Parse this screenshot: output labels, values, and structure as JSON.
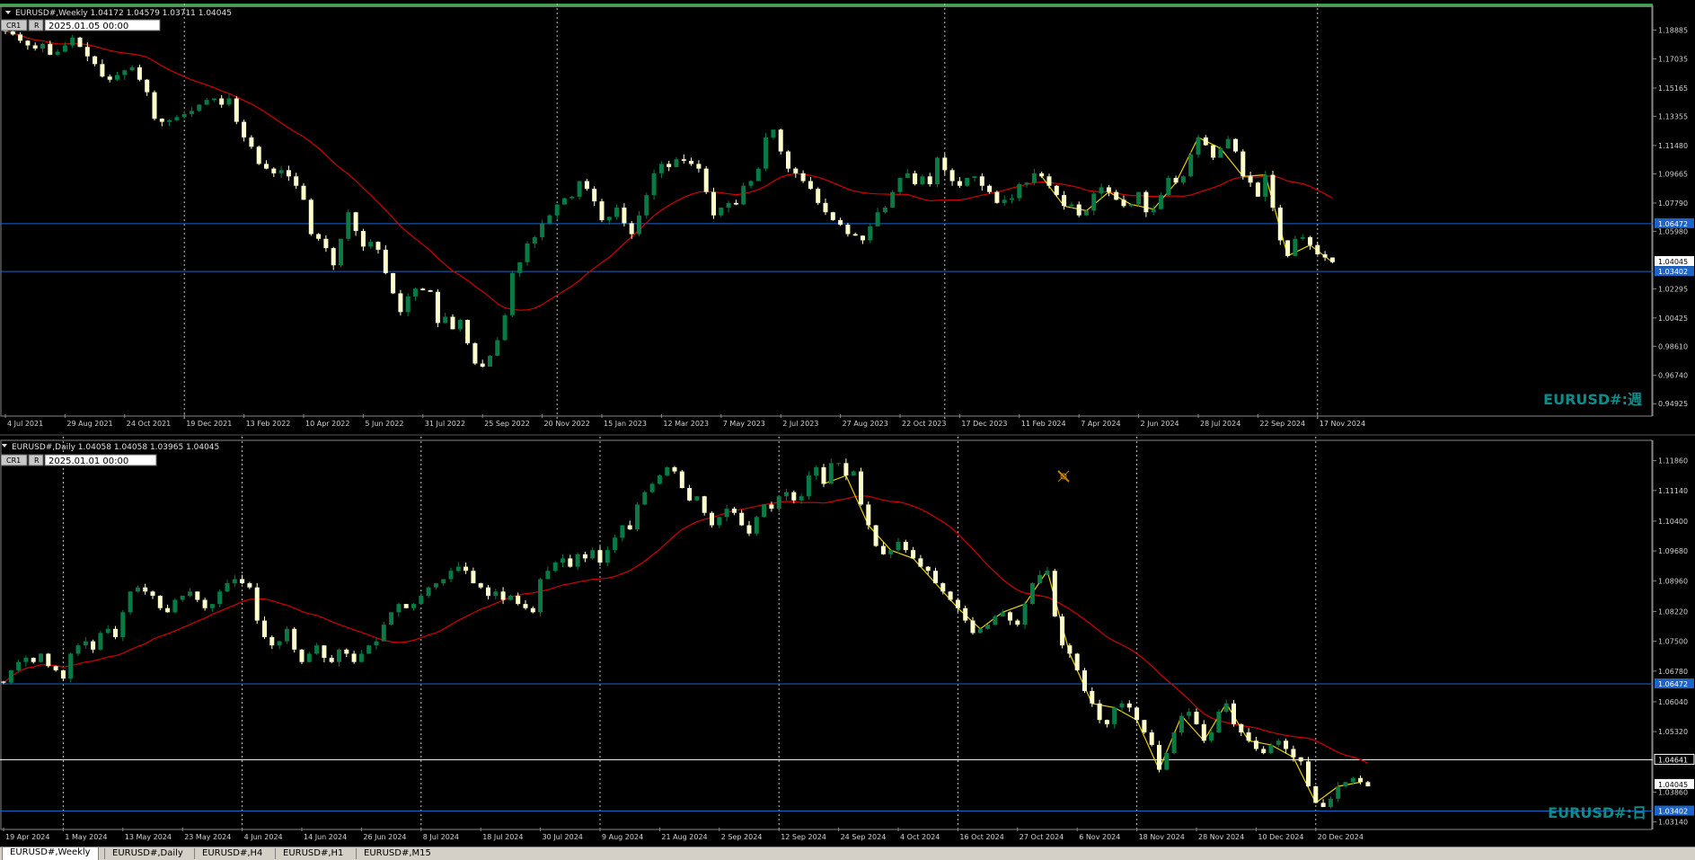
{
  "colors": {
    "background": "#000000",
    "bull_candle": "#0a7a45",
    "bear_candle": "#ffffcc",
    "ma_line": "#d40000",
    "zigzag": "#e8d000",
    "hline": "#1e64c8",
    "vgrid": "#c0c0c0",
    "label_color": "#0d8c8c",
    "top_border": "#2ea043",
    "axis_text": "#d0d0d0",
    "hline_tag": "#1e64c8",
    "price_tag": "#ffffff"
  },
  "tabs": [
    {
      "label": "EURUSD#,Weekly",
      "active": true
    },
    {
      "label": "EURUSD#,Daily",
      "active": false
    },
    {
      "label": "EURUSD#,H4",
      "active": false
    },
    {
      "label": "EURUSD#,H1",
      "active": false
    },
    {
      "label": "EURUSD#,M15",
      "active": false
    }
  ],
  "chart_data": [
    {
      "type": "candlestick",
      "header": "EURUSD#,Weekly  1.04172 1.04579 1.03711 1.04045",
      "cr_label": "CR1",
      "r_label": "R",
      "date_box": "2025.01.05 00:00",
      "watermark": "EURUSD#:週",
      "ylim": [
        0.9419,
        1.2035
      ],
      "price_ticks": [
        "1.18885",
        "1.17035",
        "1.15165",
        "1.13355",
        "1.11480",
        "1.09665",
        "1.07790",
        "1.05980",
        "1.02295",
        "1.00425",
        "0.98610",
        "0.96740",
        "0.94925"
      ],
      "price_tick_values": [
        1.18885,
        1.17035,
        1.15165,
        1.13355,
        1.1148,
        1.09665,
        1.0779,
        1.0598,
        1.02295,
        1.00425,
        0.9861,
        0.9674,
        0.94925
      ],
      "x_labels": [
        "4 Jul 2021",
        "29 Aug 2021",
        "24 Oct 2021",
        "19 Dec 2021",
        "13 Feb 2022",
        "10 Apr 2022",
        "5 Jun 2022",
        "31 Jul 2022",
        "25 Sep 2022",
        "20 Nov 2022",
        "15 Jan 2023",
        "12 Mar 2023",
        "7 May 2023",
        "2 Jul 2023",
        "27 Aug 2023",
        "22 Oct 2023",
        "17 Dec 2023",
        "11 Feb 2024",
        "7 Apr 2024",
        "2 Jun 2024",
        "28 Jul 2024",
        "22 Sep 2024",
        "17 Nov 2024"
      ],
      "x_label_index": [
        0,
        8,
        16,
        24,
        32,
        40,
        48,
        56,
        64,
        72,
        80,
        88,
        96,
        104,
        112,
        120,
        128,
        136,
        144,
        152,
        160,
        168,
        176
      ],
      "vgrid_index": [
        24,
        74,
        126,
        176
      ],
      "hlines": [
        {
          "price": 1.06472,
          "label": "1.06472"
        },
        {
          "price": 1.03402,
          "label": "1.03402"
        }
      ],
      "last_price": {
        "price": 1.04045,
        "label": "1.04045"
      },
      "closes": [
        1.188,
        1.186,
        1.182,
        1.179,
        1.177,
        1.18,
        1.173,
        1.175,
        1.179,
        1.184,
        1.178,
        1.172,
        1.167,
        1.159,
        1.157,
        1.16,
        1.163,
        1.165,
        1.157,
        1.149,
        1.132,
        1.13,
        1.131,
        1.133,
        1.135,
        1.137,
        1.141,
        1.144,
        1.145,
        1.141,
        1.145,
        1.13,
        1.12,
        1.114,
        1.103,
        1.1,
        1.097,
        1.099,
        1.095,
        1.089,
        1.08,
        1.058,
        1.055,
        1.049,
        1.038,
        1.055,
        1.072,
        1.06,
        1.05,
        1.053,
        1.048,
        1.033,
        1.02,
        1.008,
        1.018,
        1.023,
        1.022,
        1.021,
        1.001,
        1.005,
        0.997,
        1.003,
        0.988,
        0.975,
        0.973,
        0.98,
        0.99,
        1.006,
        1.033,
        1.04,
        1.052,
        1.056,
        1.065,
        1.07,
        1.077,
        1.081,
        1.082,
        1.092,
        1.087,
        1.079,
        1.067,
        1.069,
        1.075,
        1.065,
        1.058,
        1.07,
        1.083,
        1.097,
        1.103,
        1.101,
        1.106,
        1.105,
        1.103,
        1.1,
        1.085,
        1.07,
        1.075,
        1.078,
        1.077,
        1.089,
        1.092,
        1.1,
        1.12,
        1.125,
        1.111,
        1.1,
        1.097,
        1.092,
        1.087,
        1.078,
        1.072,
        1.067,
        1.064,
        1.058,
        1.057,
        1.054,
        1.063,
        1.072,
        1.075,
        1.085,
        1.094,
        1.097,
        1.09,
        1.095,
        1.09,
        1.107,
        1.099,
        1.092,
        1.089,
        1.094,
        1.095,
        1.089,
        1.085,
        1.078,
        1.08,
        1.081,
        1.09,
        1.091,
        1.097,
        1.095,
        1.089,
        1.083,
        1.076,
        1.077,
        1.07,
        1.073,
        1.084,
        1.088,
        1.085,
        1.08,
        1.076,
        1.077,
        1.085,
        1.072,
        1.074,
        1.083,
        1.094,
        1.091,
        1.095,
        1.109,
        1.12,
        1.115,
        1.107,
        1.113,
        1.119,
        1.111,
        1.095,
        1.091,
        1.082,
        1.096,
        1.075,
        1.054,
        1.044,
        1.055,
        1.056,
        1.051,
        1.045,
        1.043,
        1.04
      ]
    },
    {
      "type": "candlestick",
      "header": "EURUSD#,Daily  1.04058 1.04058 1.03965 1.04045",
      "cr_label": "CR1",
      "r_label": "R",
      "date_box": "2025.01.01 00:00",
      "watermark": "EURUSD#:日",
      "ylim": [
        1.0298,
        1.1235
      ],
      "price_ticks": [
        "1.11860",
        "1.11140",
        "1.10400",
        "1.09680",
        "1.08960",
        "1.08220",
        "1.07500",
        "1.06780",
        "1.06040",
        "1.05320",
        "1.03860",
        "1.03140"
      ],
      "price_tick_values": [
        1.1186,
        1.1114,
        1.104,
        1.0968,
        1.0896,
        1.0822,
        1.075,
        1.0678,
        1.0604,
        1.0532,
        1.0386,
        1.0314
      ],
      "x_labels": [
        "19 Apr 2024",
        "1 May 2024",
        "13 May 2024",
        "23 May 2024",
        "4 Jun 2024",
        "14 Jun 2024",
        "26 Jun 2024",
        "8 Jul 2024",
        "18 Jul 2024",
        "30 Jul 2024",
        "9 Aug 2024",
        "21 Aug 2024",
        "2 Sep 2024",
        "12 Sep 2024",
        "24 Sep 2024",
        "4 Oct 2024",
        "16 Oct 2024",
        "27 Oct 2024",
        "6 Nov 2024",
        "18 Nov 2024",
        "28 Nov 2024",
        "10 Dec 2024",
        "20 Dec 2024"
      ],
      "x_label_index": [
        0,
        8,
        16,
        24,
        32,
        40,
        48,
        56,
        64,
        72,
        80,
        88,
        96,
        104,
        112,
        120,
        128,
        136,
        144,
        152,
        160,
        168,
        176
      ],
      "vgrid_index": [
        8,
        32,
        56,
        80,
        104,
        128,
        152,
        176
      ],
      "hlines": [
        {
          "price": 1.06472,
          "label": "1.06472"
        },
        {
          "price": 1.03402,
          "label": "1.03402"
        }
      ],
      "white_line": {
        "price": 1.04641,
        "label": "1.04641"
      },
      "last_price": {
        "price": 1.04045,
        "label": "1.04045"
      },
      "closes": [
        1.065,
        1.068,
        1.07,
        1.071,
        1.07,
        1.072,
        1.069,
        1.068,
        1.066,
        1.072,
        1.074,
        1.075,
        1.073,
        1.077,
        1.078,
        1.076,
        1.082,
        1.087,
        1.088,
        1.087,
        1.086,
        1.083,
        1.082,
        1.085,
        1.086,
        1.087,
        1.085,
        1.083,
        1.084,
        1.087,
        1.089,
        1.09,
        1.089,
        1.088,
        1.08,
        1.076,
        1.074,
        1.075,
        1.078,
        1.073,
        1.07,
        1.072,
        1.074,
        1.071,
        1.07,
        1.073,
        1.072,
        1.07,
        1.072,
        1.074,
        1.075,
        1.079,
        1.082,
        1.084,
        1.083,
        1.084,
        1.086,
        1.088,
        1.089,
        1.09,
        1.092,
        1.093,
        1.092,
        1.089,
        1.088,
        1.086,
        1.087,
        1.085,
        1.086,
        1.084,
        1.083,
        1.082,
        1.09,
        1.092,
        1.094,
        1.095,
        1.093,
        1.096,
        1.095,
        1.097,
        1.094,
        1.097,
        1.1,
        1.103,
        1.102,
        1.108,
        1.111,
        1.113,
        1.115,
        1.117,
        1.116,
        1.112,
        1.109,
        1.11,
        1.106,
        1.103,
        1.105,
        1.107,
        1.106,
        1.103,
        1.101,
        1.105,
        1.108,
        1.107,
        1.11,
        1.111,
        1.109,
        1.11,
        1.115,
        1.117,
        1.113,
        1.118,
        1.118,
        1.115,
        1.116,
        1.108,
        1.103,
        1.098,
        1.096,
        1.097,
        1.099,
        1.097,
        1.095,
        1.093,
        1.092,
        1.089,
        1.087,
        1.085,
        1.083,
        1.08,
        1.077,
        1.078,
        1.079,
        1.081,
        1.082,
        1.08,
        1.079,
        1.084,
        1.089,
        1.091,
        1.092,
        1.081,
        1.074,
        1.072,
        1.068,
        1.063,
        1.06,
        1.056,
        1.055,
        1.059,
        1.06,
        1.059,
        1.056,
        1.053,
        1.05,
        1.044,
        1.048,
        1.053,
        1.057,
        1.058,
        1.055,
        1.051,
        1.053,
        1.058,
        1.06,
        1.055,
        1.053,
        1.051,
        1.049,
        1.048,
        1.05,
        1.051,
        1.049,
        1.047,
        1.046,
        1.04,
        1.036,
        1.035,
        1.037,
        1.04,
        1.041,
        1.042,
        1.041,
        1.04
      ]
    }
  ]
}
